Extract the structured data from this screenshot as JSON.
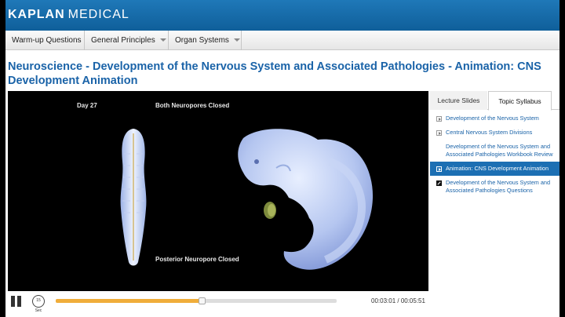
{
  "header": {
    "brand": "KAPLAN",
    "product": "MEDICAL"
  },
  "nav": {
    "items": [
      {
        "label": "Warm-up Questions",
        "has_dropdown": false
      },
      {
        "label": "General Principles",
        "has_dropdown": true
      },
      {
        "label": "Organ Systems",
        "has_dropdown": true
      }
    ]
  },
  "page": {
    "title": "Neuroscience - Development of the Nervous System and Associated Pathologies - Animation: CNS Development Animation"
  },
  "video": {
    "day_label": "Day 27",
    "top_caption": "Both Neuropores Closed",
    "bottom_caption": "Posterior Neuropore Closed"
  },
  "player": {
    "replay_label": "15 Sec",
    "progress": 0.52,
    "current_time": "00:03:01",
    "total_time": "00:05:51",
    "time_separator": " / ",
    "accent_color": "#f0ad3a"
  },
  "side": {
    "tabs": [
      {
        "label": "Lecture Slides",
        "active": false
      },
      {
        "label": "Topic Syllabus",
        "active": true
      }
    ],
    "syllabus": [
      {
        "label": "Development of the Nervous System",
        "icon": "play-icon",
        "active": false
      },
      {
        "label": "Central Nervous System Divisions",
        "icon": "play-icon",
        "active": false
      },
      {
        "label": "Development of the Nervous System and Associated Pathologies Workbook Review",
        "icon": "none",
        "active": false
      },
      {
        "label": "Animation: CNS Development Animation",
        "icon": "play-icon",
        "active": true
      },
      {
        "label": "Development of the Nervous System and Associated Pathologies Questions",
        "icon": "quiz-icon",
        "active": false
      }
    ]
  },
  "colors": {
    "brand_blue": "#1a63a8",
    "header_blue": "#1878b8",
    "active_item": "#1c6fb3"
  }
}
